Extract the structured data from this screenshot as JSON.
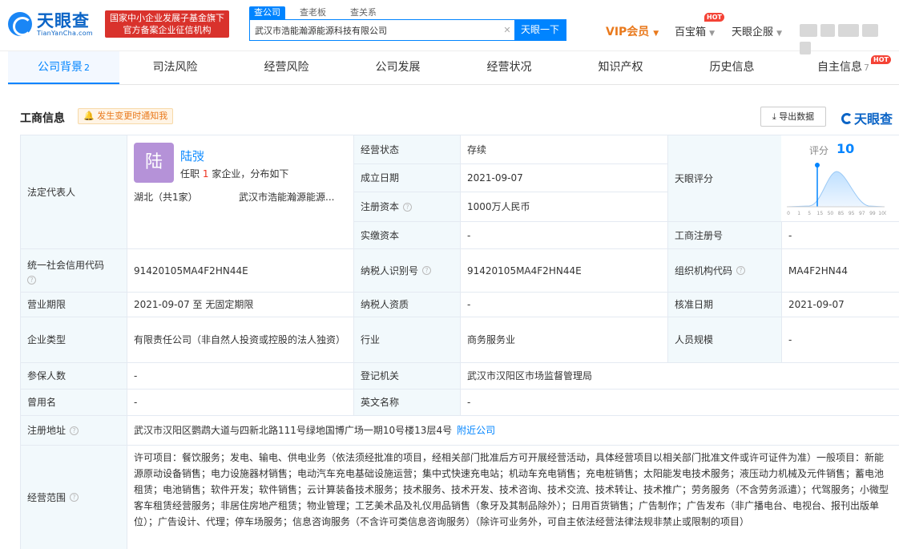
{
  "header": {
    "logo_cn": "天眼查",
    "logo_en": "TianYanCha.com",
    "slogan_line1": "国家中小企业发展子基金旗下",
    "slogan_line2": "官方备案企业征信机构",
    "search_tabs": [
      "查公司",
      "查老板",
      "查关系"
    ],
    "search_value": "武汉市浩能瀚源能源科技有限公司",
    "search_button": "天眼一下",
    "vip_label": "VIP会员",
    "baibao_label": "百宝箱",
    "hot_label": "HOT",
    "qiyeban_label": "天眼企服"
  },
  "nav": {
    "tabs": [
      {
        "label": "公司背景",
        "count": "2"
      },
      {
        "label": "司法风险",
        "count": ""
      },
      {
        "label": "经营风险",
        "count": ""
      },
      {
        "label": "公司发展",
        "count": ""
      },
      {
        "label": "经营状况",
        "count": ""
      },
      {
        "label": "知识产权",
        "count": ""
      },
      {
        "label": "历史信息",
        "count": ""
      },
      {
        "label": "自主信息",
        "count": "7"
      }
    ],
    "hot_label": "HOT"
  },
  "section": {
    "title": "工商信息",
    "notify_label": "发生变更时通知我",
    "export_label": "导出数据",
    "brand": "天眼查"
  },
  "rep": {
    "label": "法定代表人",
    "avatar_char": "陆",
    "name": "陆弢",
    "desc_prefix": "任职",
    "desc_count": "1",
    "desc_suffix": "家企业，分布如下",
    "region": "湖北（共1家）",
    "corp": "武汉市浩能瀚源能源..."
  },
  "score": {
    "label": "天眼评分",
    "score_prefix": "评分",
    "score_value": "10",
    "axis_ticks": [
      "0",
      "1",
      "5",
      "15",
      "50",
      "85",
      "95",
      "97",
      "99",
      "100"
    ]
  },
  "fields": {
    "status_label": "经营状态",
    "status": "存续",
    "found_label": "成立日期",
    "found": "2021-09-07",
    "capital_label": "注册资本",
    "capital": "1000万人民币",
    "paid_label": "实缴资本",
    "paid": "-",
    "regno_label": "工商注册号",
    "regno": "-",
    "credit_label": "统一社会信用代码",
    "credit": "91420105MA4F2HN44E",
    "taxid_label": "纳税人识别号",
    "taxid": "91420105MA4F2HN44E",
    "orgcode_label": "组织机构代码",
    "orgcode": "MA4F2HN44",
    "term_label": "营业期限",
    "term": "2021-09-07 至 无固定期限",
    "taxqual_label": "纳税人资质",
    "taxqual": "-",
    "approve_label": "核准日期",
    "approve": "2021-09-07",
    "type_label": "企业类型",
    "type": "有限责任公司（非自然人投资或控股的法人独资）",
    "industry_label": "行业",
    "industry": "商务服务业",
    "staff_label": "人员规模",
    "staff": "-",
    "insured_label": "参保人数",
    "insured": "-",
    "authority_label": "登记机关",
    "authority": "武汉市汉阳区市场监督管理局",
    "oldname_label": "曾用名",
    "oldname": "-",
    "english_label": "英文名称",
    "english": "-",
    "address_label": "注册地址",
    "address": "武汉市汉阳区鹦鹉大道与四新北路111号绿地国博广场一期10号楼13层4号",
    "nearby_label": "附近公司",
    "scope_label": "经营范围",
    "scope": "许可项目：餐饮服务；发电、输电、供电业务（依法须经批准的项目，经相关部门批准后方可开展经营活动，具体经营项目以相关部门批准文件或许可证件为准）一般项目：新能源原动设备销售；电力设施器材销售；电动汽车充电基础设施运营；集中式快速充电站；机动车充电销售；充电桩销售；太阳能发电技术服务；液压动力机械及元件销售；蓄电池租赁；电池销售；软件开发；软件销售；云计算装备技术服务；技术服务、技术开发、技术咨询、技术交流、技术转让、技术推广；劳务服务（不含劳务派遣）；代驾服务；小微型客车租赁经营服务；非居住房地产租赁；物业管理；工艺美术品及礼仪用品销售（象牙及其制品除外）；日用百货销售；广告制作；广告发布（非广播电台、电视台、报刊出版单位）；广告设计、代理；停车场服务；信息咨询服务（不含许可类信息咨询服务）（除许可业务外，可自主依法经营法律法规非禁止或限制的项目）"
  },
  "colors": {
    "accent": "#0084ff",
    "label_bg": "#f2f9fc",
    "slogan_bg": "#d9322c",
    "vip": "#e9791c"
  }
}
